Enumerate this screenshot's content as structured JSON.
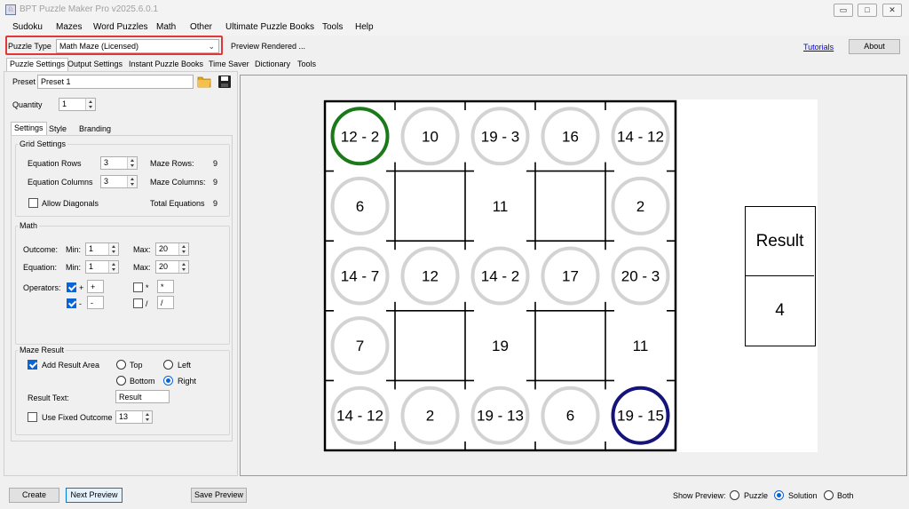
{
  "window": {
    "title": "BPT Puzzle Maker Pro v2025.6.0.1"
  },
  "menu": [
    "Sudoku",
    "Mazes",
    "Word Puzzles",
    "Math",
    "Other",
    "Ultimate Puzzle Books",
    "Tools",
    "Help"
  ],
  "toolbar": {
    "puzzle_type_label": "Puzzle Type",
    "puzzle_type_value": "Math Maze (Licensed)",
    "status": "Preview Rendered ...",
    "tutorials": "Tutorials",
    "about": "About"
  },
  "tabs": [
    "Puzzle Settings",
    "Output Settings",
    "Instant Puzzle Books",
    "Time Saver",
    "Dictionary",
    "Tools"
  ],
  "settings": {
    "preset_label": "Preset",
    "preset_value": "Preset 1",
    "quantity_label": "Quantity",
    "quantity_value": "1",
    "subtabs": [
      "Settings",
      "Style",
      "Branding"
    ],
    "grid": {
      "title": "Grid Settings",
      "eq_rows_label": "Equation Rows",
      "eq_rows_value": "3",
      "eq_cols_label": "Equation Columns",
      "eq_cols_value": "3",
      "maze_rows_label": "Maze Rows:",
      "maze_rows_value": "9",
      "maze_cols_label": "Maze Columns:",
      "maze_cols_value": "9",
      "diagonals_label": "Allow Diagonals",
      "total_label": "Total Equations",
      "total_value": "9"
    },
    "math": {
      "title": "Math",
      "outcome_label": "Outcome:",
      "equation_label": "Equation:",
      "min_label": "Min:",
      "max_label": "Max:",
      "outcome_min": "1",
      "outcome_max": "20",
      "equation_min": "1",
      "equation_max": "20",
      "operators_label": "Operators:",
      "op_plus_sym": "+",
      "op_plus_val": "+",
      "op_minus_sym": "-",
      "op_minus_val": "-",
      "op_mul_sym": "*",
      "op_mul_val": "*",
      "op_div_sym": "/",
      "op_div_val": "/"
    },
    "result": {
      "title": "Maze Result",
      "add_label": "Add Result Area",
      "top": "Top",
      "left": "Left",
      "bottom": "Bottom",
      "right": "Right",
      "text_label": "Result Text:",
      "text_value": "Result",
      "fixed_label": "Use Fixed Outcome",
      "fixed_value": "13"
    }
  },
  "maze": {
    "cells": [
      [
        "12 - 2",
        "10",
        "19 - 3",
        "16",
        "14 - 12"
      ],
      [
        "6",
        "",
        "11",
        "",
        "2"
      ],
      [
        "14 - 7",
        "12",
        "14 - 2",
        "17",
        "20 - 3"
      ],
      [
        "7",
        "",
        "19",
        "",
        "11"
      ],
      [
        "14 - 12",
        "2",
        "19 - 13",
        "6",
        "19 - 15"
      ]
    ],
    "start_color": "#1a7a1a",
    "end_color": "#14147a",
    "circle_color": "#d3d3d3",
    "result_title": "Result",
    "result_value": "4"
  },
  "bottom": {
    "create": "Create",
    "next": "Next Preview",
    "save": "Save Preview",
    "show_label": "Show Preview:",
    "opt_puzzle": "Puzzle",
    "opt_solution": "Solution",
    "opt_both": "Both"
  }
}
